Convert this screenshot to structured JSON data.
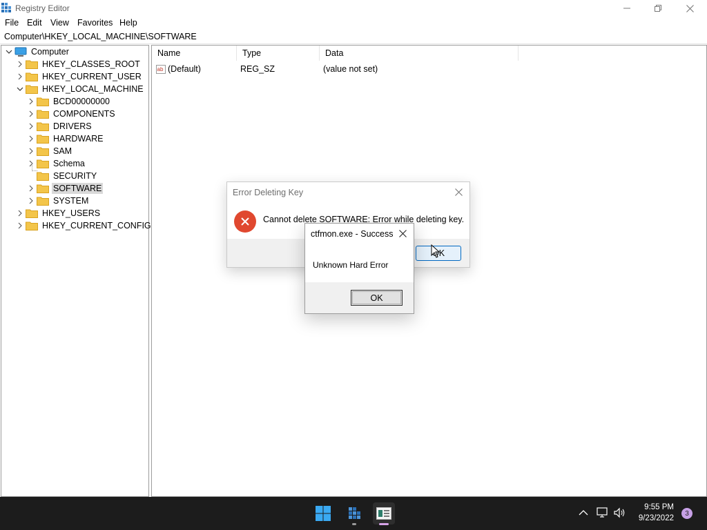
{
  "window": {
    "title": "Registry Editor",
    "controls": [
      "minimize-icon",
      "restore-icon",
      "close-icon"
    ]
  },
  "menu": [
    "File",
    "Edit",
    "View",
    "Favorites",
    "Help"
  ],
  "address": "Computer\\HKEY_LOCAL_MACHINE\\SOFTWARE",
  "tree": {
    "root": "Computer",
    "hives": {
      "classes_root": "HKEY_CLASSES_ROOT",
      "current_user": "HKEY_CURRENT_USER",
      "local_machine": "HKEY_LOCAL_MACHINE",
      "users": "HKEY_USERS",
      "current_config": "HKEY_CURRENT_CONFIG"
    },
    "hklm_children": [
      "BCD00000000",
      "COMPONENTS",
      "DRIVERS",
      "HARDWARE",
      "SAM",
      "Schema",
      "SECURITY",
      "SOFTWARE",
      "SYSTEM"
    ],
    "selected": "SOFTWARE"
  },
  "list": {
    "columns": [
      "Name",
      "Type",
      "Data"
    ],
    "rows": [
      {
        "name": "(Default)",
        "type": "REG_SZ",
        "data": "(value not set)",
        "icon": "string-value-icon"
      }
    ]
  },
  "error_dialog": {
    "title": "Error Deleting Key",
    "message": "Cannot delete SOFTWARE:  Error while deleting key.",
    "ok_label": "OK",
    "icon": "error-icon"
  },
  "success_dialog": {
    "title": "ctfmon.exe - Success",
    "message": "Unknown Hard Error",
    "ok_label": "OK"
  },
  "taskbar": {
    "apps": [
      "start-icon",
      "registry-editor-icon",
      "app-window-icon"
    ],
    "time": "9:55 PM",
    "date": "9/23/2022",
    "notification_count": "3"
  },
  "colors": {
    "taskbar": "#1c1c1c",
    "error_red": "#e0482f",
    "folder": "#f3c54a",
    "selection": "#d9d9d9",
    "dialog_footer": "#f0f0f0",
    "ok_focus_border": "#0067c0"
  }
}
